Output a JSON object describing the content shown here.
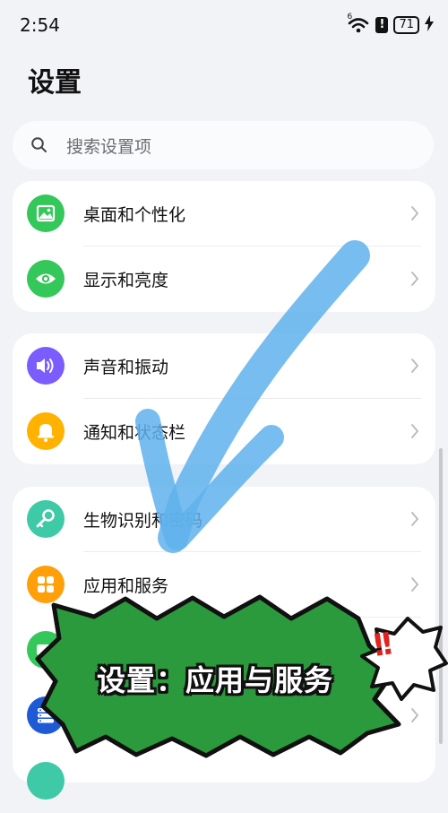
{
  "status_bar": {
    "time": "2:54",
    "network_badge": "6",
    "alert_glyph": "!",
    "battery": "71"
  },
  "header": {
    "title": "设置"
  },
  "search": {
    "placeholder": "搜索设置项"
  },
  "settings": {
    "group1": [
      {
        "label": "桌面和个性化",
        "icon": "picture-icon",
        "color": "#34c759"
      },
      {
        "label": "显示和亮度",
        "icon": "eye-icon",
        "color": "#34c759"
      }
    ],
    "group2": [
      {
        "label": "声音和振动",
        "icon": "speaker-icon",
        "color": "#7b5cff"
      },
      {
        "label": "通知和状态栏",
        "icon": "bell-icon",
        "color": "#ffb300"
      }
    ],
    "group3": [
      {
        "label": "生物识别和密码",
        "icon": "key-icon",
        "color": "#3ec9a7"
      },
      {
        "label": "应用和服务",
        "icon": "apps-icon",
        "color": "#ff9f0a"
      },
      {
        "label": "",
        "icon": "battery-icon",
        "color": "#34c759"
      },
      {
        "label": "",
        "icon": "storage-icon",
        "color": "#1e5ad6"
      },
      {
        "label": "",
        "icon": "partial-icon",
        "color": "#3ec9a7"
      }
    ]
  },
  "overlay": {
    "banner_text": "设置：应用与服务",
    "exclaim": "!!",
    "colors": {
      "banner": "#2b9a3c",
      "arrow": "#5fb2ec",
      "exclaim": "#e0231f"
    }
  }
}
